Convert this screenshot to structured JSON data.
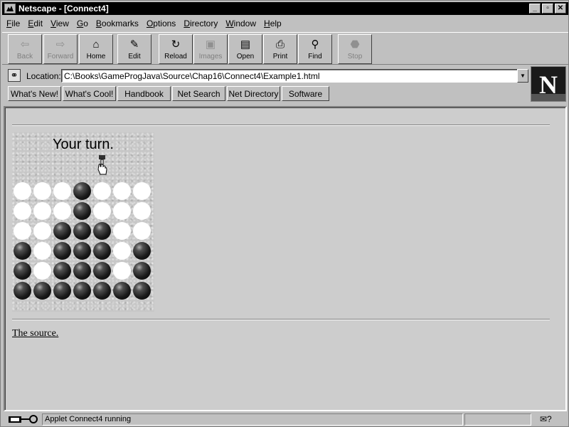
{
  "window": {
    "title": "Netscape - [Connect4]"
  },
  "window_buttons": {
    "minimize": "_",
    "maximize": "▫",
    "close": "✕"
  },
  "menu": [
    {
      "key": "F",
      "rest": "ile"
    },
    {
      "key": "E",
      "rest": "dit"
    },
    {
      "key": "V",
      "rest": "iew"
    },
    {
      "key": "G",
      "rest": "o"
    },
    {
      "key": "B",
      "rest": "ookmarks"
    },
    {
      "key": "O",
      "rest": "ptions"
    },
    {
      "key": "D",
      "rest": "irectory"
    },
    {
      "key": "W",
      "rest": "indow"
    },
    {
      "key": "H",
      "rest": "elp"
    }
  ],
  "toolbar": {
    "back": "Back",
    "forward": "Forward",
    "home": "Home",
    "edit": "Edit",
    "reload": "Reload",
    "images": "Images",
    "open": "Open",
    "print": "Print",
    "find": "Find",
    "stop": "Stop"
  },
  "location": {
    "label": "Location:",
    "url": "C:\\Books\\GameProgJava\\Source\\Chap16\\Connect4\\Example1.html"
  },
  "directory_buttons": {
    "whats_new": "What's New!",
    "whats_cool": "What's Cool!",
    "handbook": "Handbook",
    "net_search": "Net Search",
    "net_directory": "Net Directory",
    "software": "Software"
  },
  "logo": {
    "letter": "N"
  },
  "applet": {
    "status_message": "Your turn.",
    "board": [
      [
        "W",
        "W",
        "W",
        "B",
        "W",
        "W",
        "W"
      ],
      [
        "W",
        "W",
        "W",
        "B",
        "W",
        "W",
        "W"
      ],
      [
        "W",
        "W",
        "B",
        "B",
        "B",
        "W",
        "W"
      ],
      [
        "B",
        "W",
        "B",
        "B",
        "B",
        "W",
        "B"
      ],
      [
        "B",
        "W",
        "B",
        "B",
        "B",
        "W",
        "B"
      ],
      [
        "B",
        "B",
        "B",
        "B",
        "B",
        "B",
        "B"
      ]
    ],
    "pointer_column": 4
  },
  "page": {
    "source_link": "The source."
  },
  "status": {
    "message": "Applet Connect4 running"
  }
}
